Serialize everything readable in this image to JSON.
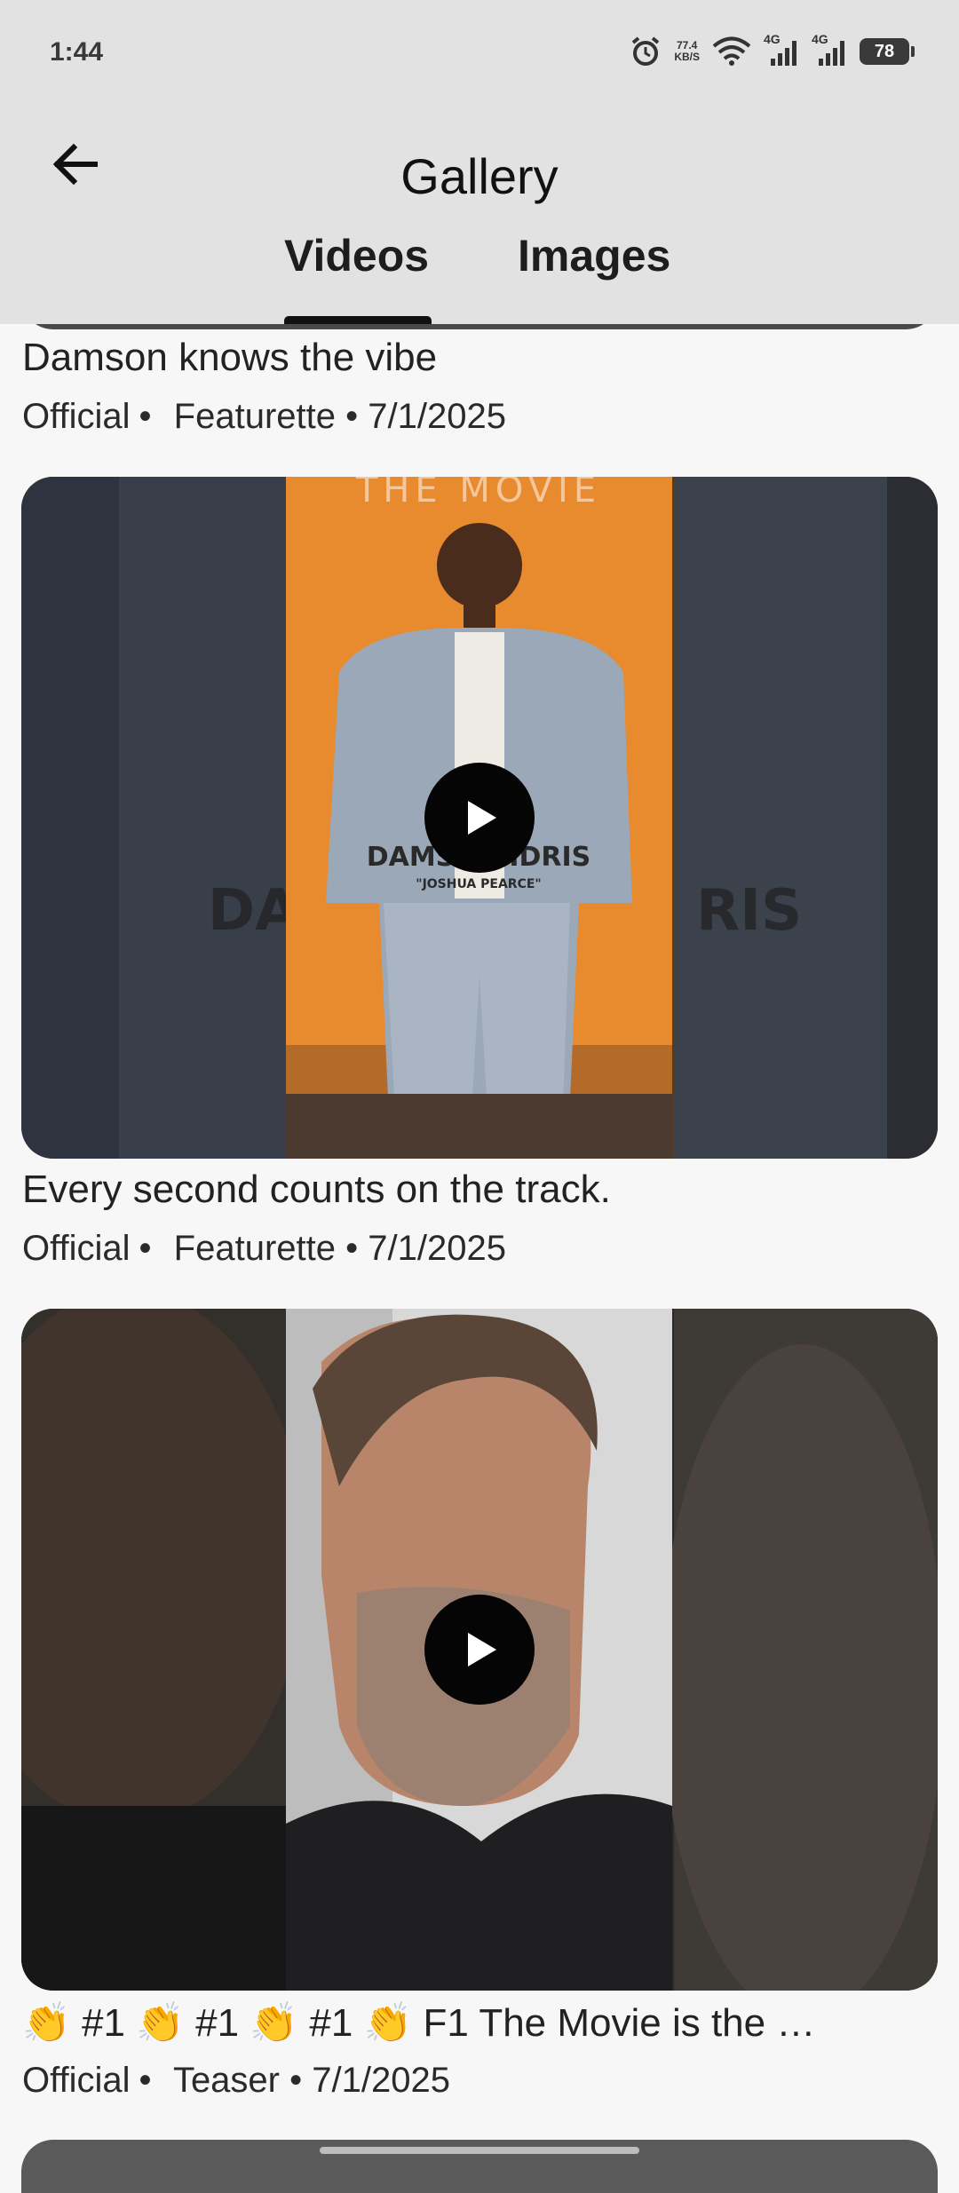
{
  "status_bar": {
    "time": "1:44",
    "net_speed_value": "77.4",
    "net_speed_unit": "KB/S",
    "signal1_label": "4G",
    "signal2_label": "4G",
    "battery": "78"
  },
  "header": {
    "title": "Gallery",
    "tabs": [
      {
        "label": "Videos",
        "selected": true
      },
      {
        "label": "Images",
        "selected": false
      }
    ]
  },
  "videos": [
    {
      "title": "Damson knows the vibe",
      "source": "Official",
      "category": "Featurette",
      "date": "7/1/2025"
    },
    {
      "title": "Every second counts on the track.",
      "source": "Official",
      "category": "Featurette",
      "date": "7/1/2025",
      "thumb_text": "DAMSON IDRIS",
      "thumb_subtext": "\"JOSHUA PEARCE\"",
      "thumb_banner": "THE MOVIE"
    },
    {
      "title": "👏 #1 👏 #1 👏 #1 👏  F1 The Movie is the …",
      "source": "Official",
      "category": "Teaser",
      "date": "7/1/2025"
    }
  ],
  "colors": {
    "app_bar": "#e2e2e2",
    "background": "#f7f7f7",
    "play_button": "#050505"
  }
}
